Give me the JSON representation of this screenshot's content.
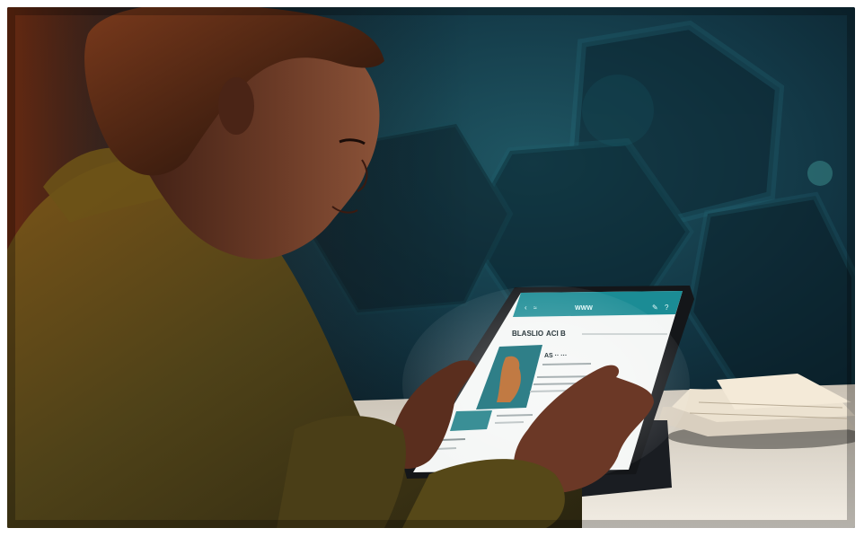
{
  "scene": {
    "description_type": "photo",
    "tablet_app": {
      "header_title": "WWW",
      "heading": "BLASLIO",
      "subheading": "ACI B",
      "card_title": "AS ·· ···",
      "icons": [
        "back-icon",
        "wifi-icon",
        "edit-icon",
        "help-icon"
      ]
    }
  },
  "colors": {
    "background": "#0e2a36",
    "teal_accent": "#1b8c95",
    "shirt": "#4f4218",
    "skin": "#5a3020",
    "table": "#e8e2d6"
  }
}
